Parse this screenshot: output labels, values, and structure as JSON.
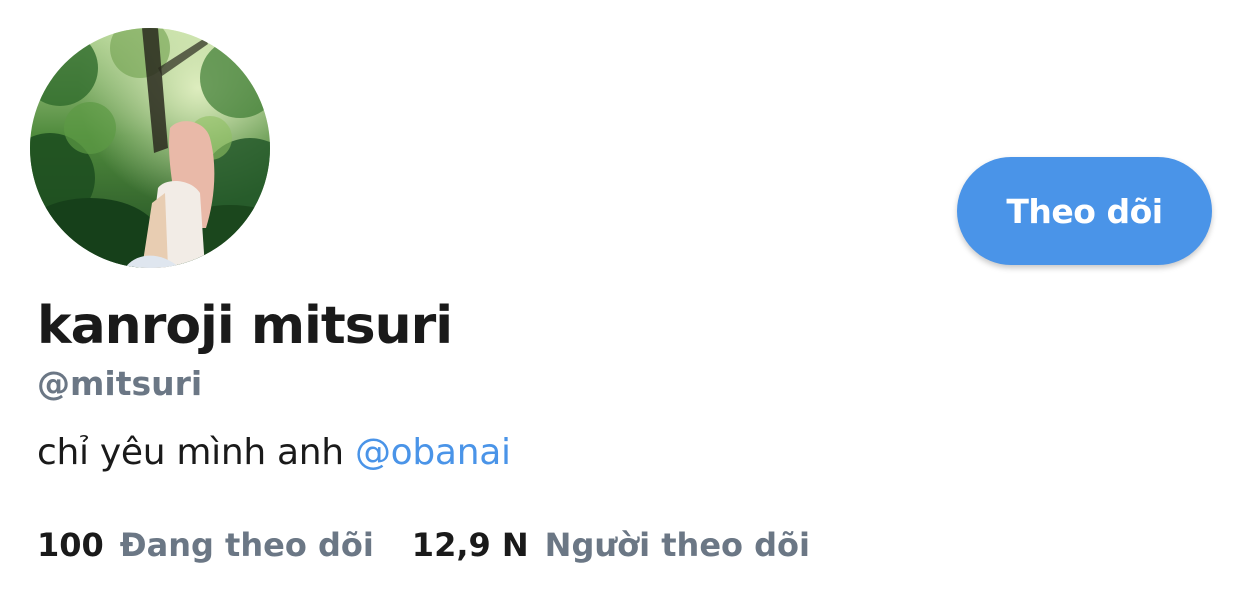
{
  "profile": {
    "display_name": "kanroji mitsuri",
    "handle": "@mitsuri",
    "bio_text": "chỉ yêu mình anh ",
    "bio_mention": "@obanai"
  },
  "follow_button": {
    "label": "Theo dõi"
  },
  "stats": {
    "following_count": "100",
    "following_label": "Đang theo dõi",
    "followers_count": "12,9 N",
    "followers_label": "Người theo dõi"
  },
  "colors": {
    "accent": "#4a94e8",
    "text_primary": "#1a1a1a",
    "text_secondary": "#6b7785",
    "background": "#ffffff"
  }
}
